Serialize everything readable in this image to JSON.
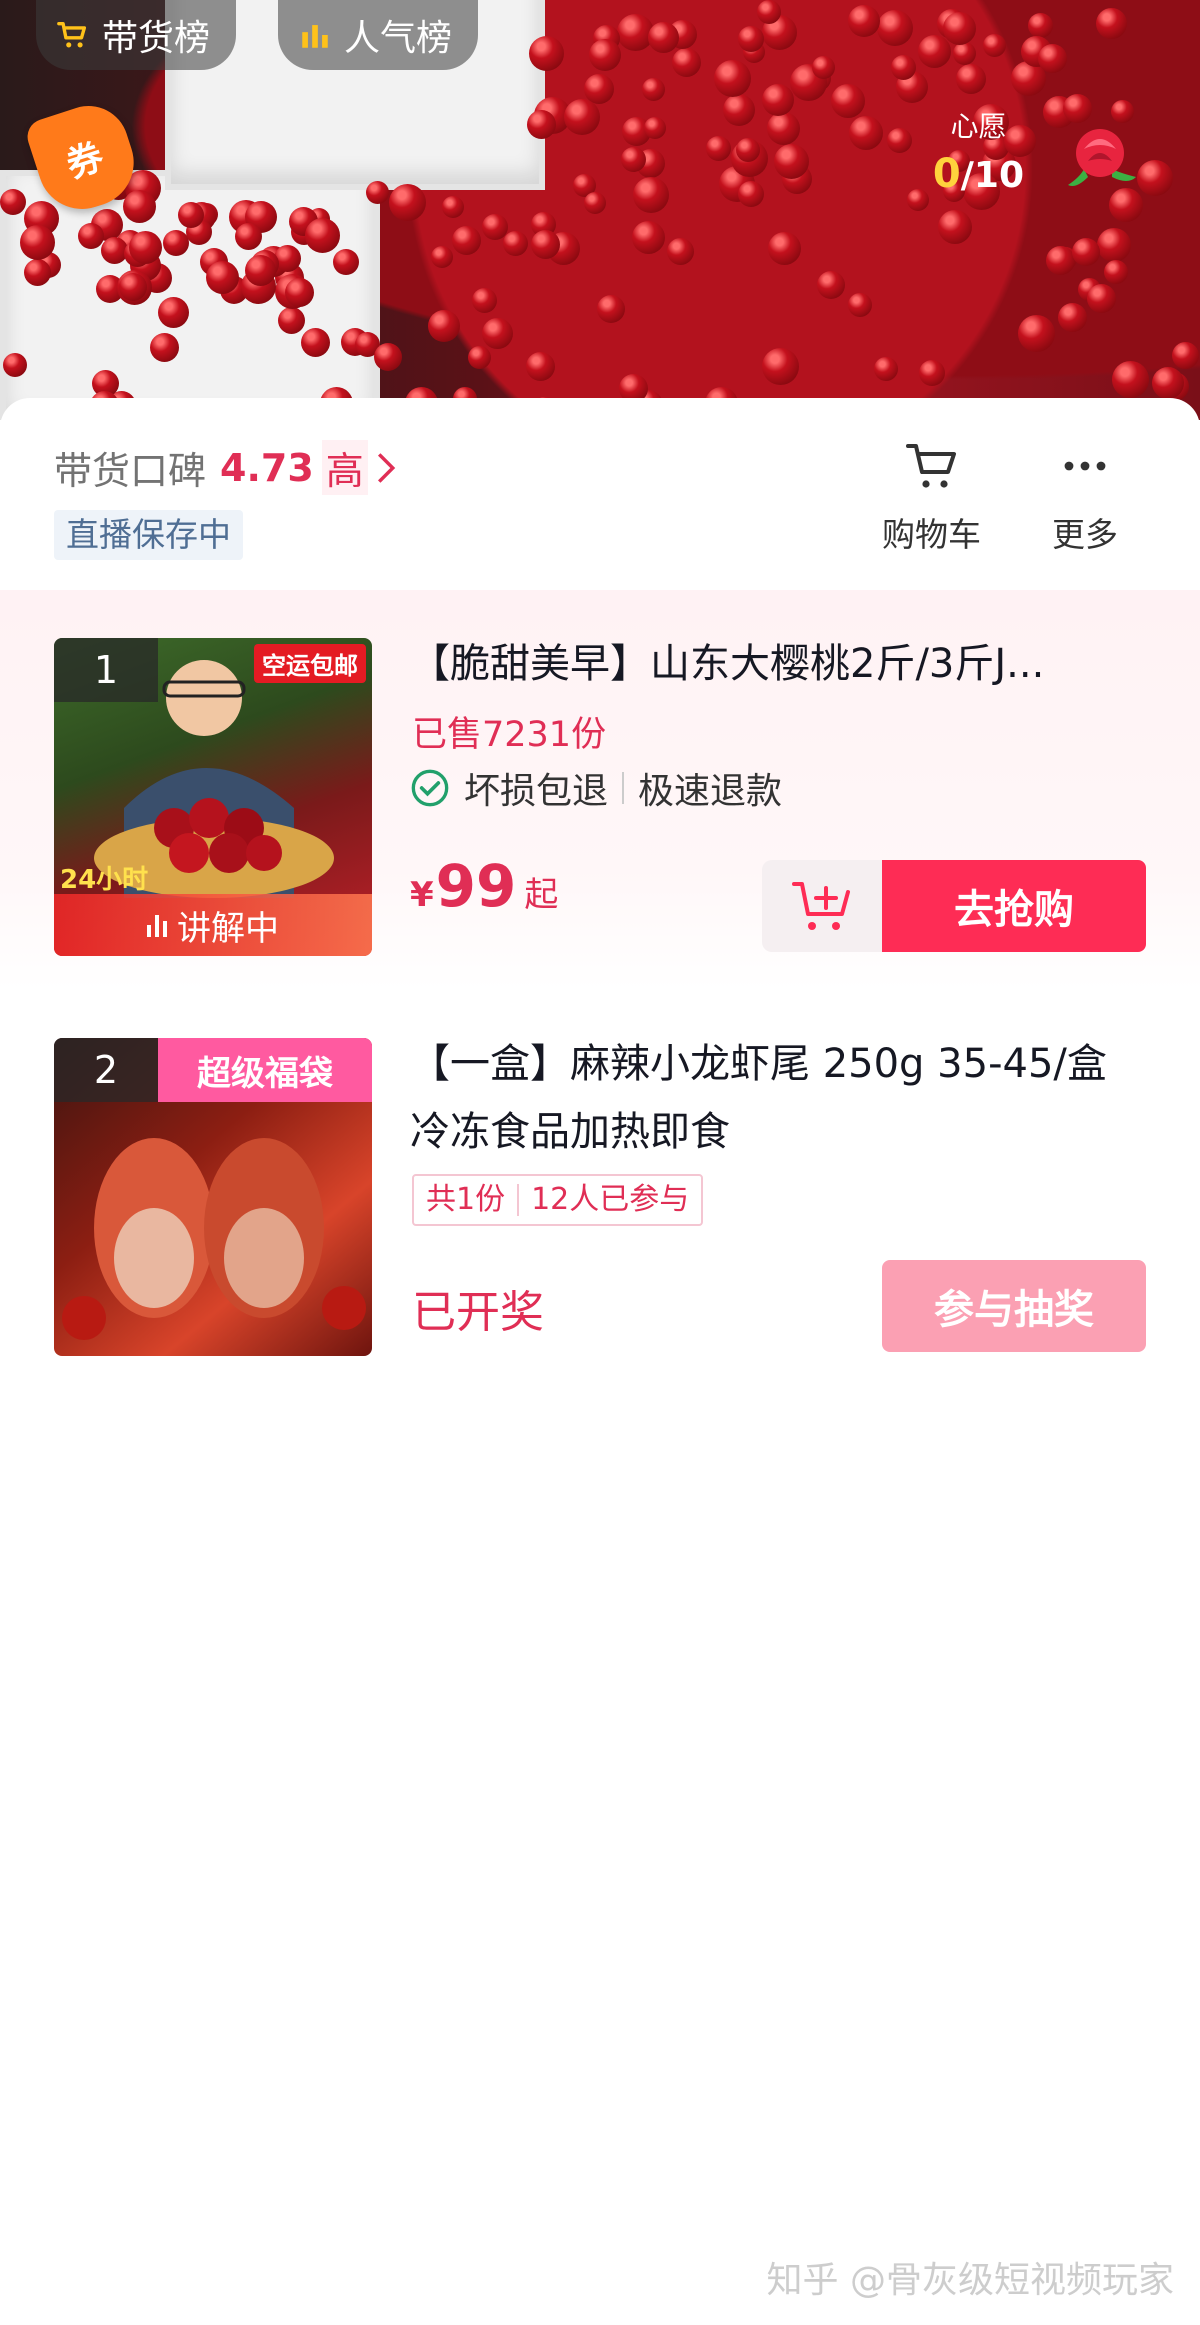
{
  "video": {
    "tabs": [
      {
        "label": "带货榜",
        "icon": "cart-icon"
      },
      {
        "label": "人气榜",
        "icon": "bar-chart-icon"
      }
    ],
    "coupon_label": "券",
    "wish": {
      "label": "心愿",
      "current": "0",
      "total": "/10",
      "icon": "rose-icon"
    }
  },
  "header": {
    "rating_label": "带货口碑",
    "rating_score": "4.73",
    "rating_level": "高",
    "saving_status": "直播保存中",
    "cart_label": "购物车",
    "more_label": "更多"
  },
  "products": [
    {
      "rank": "1",
      "thumb_tag": "空运包邮",
      "status": "讲解中",
      "title": "【脆甜美早】山东大樱桃2斤/3斤J...",
      "sold": "已售7231份",
      "guarantees": [
        "坏损包退",
        "极速退款"
      ],
      "price_symbol": "¥",
      "price": "99",
      "price_suffix": "起",
      "buy_label": "去抢购"
    },
    {
      "rank": "2",
      "thumb_tag": "超级福袋",
      "title": "【一盒】麻辣小龙虾尾 250g 35-45/盒 冷冻食品加热即食",
      "lottery_count": "共1份",
      "lottery_participants": "12人已参与",
      "lottery_status": "已开奖",
      "join_label": "参与抽奖"
    }
  ],
  "colors": {
    "accent": "#fe2c55",
    "price": "#e02e55",
    "join_disabled": "#fba0b3"
  },
  "watermark": "知乎 @骨灰级短视频玩家"
}
